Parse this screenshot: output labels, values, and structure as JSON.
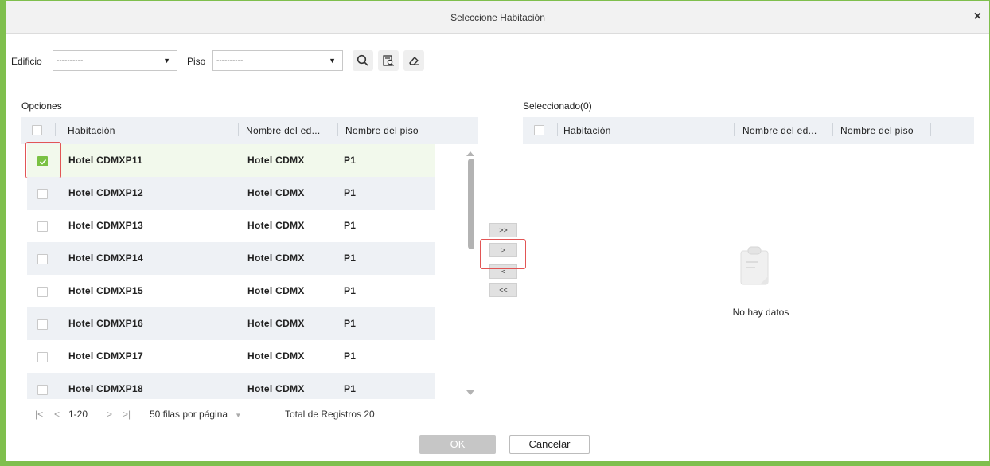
{
  "dialog": {
    "title": "Seleccione Habitación",
    "close_label": "×"
  },
  "filters": {
    "building_label": "Edificio",
    "building_value": "----------",
    "floor_label": "Piso",
    "floor_value": "----------"
  },
  "icons": {
    "search": "search-icon",
    "advanced_search": "advanced-search-icon",
    "clear": "eraser-icon",
    "empty": "clipboard-icon"
  },
  "colors": {
    "accent": "#7ac143",
    "border": "#7fbf4d",
    "highlight": "#e25555"
  },
  "options": {
    "section_label": "Opciones",
    "columns": [
      "Habitación",
      "Nombre del ed...",
      "Nombre del piso"
    ],
    "rows": [
      {
        "room": "Hotel CDMXP11",
        "building": "Hotel CDMX",
        "floor": "P1",
        "checked": true
      },
      {
        "room": "Hotel CDMXP12",
        "building": "Hotel CDMX",
        "floor": "P1",
        "checked": false
      },
      {
        "room": "Hotel CDMXP13",
        "building": "Hotel CDMX",
        "floor": "P1",
        "checked": false
      },
      {
        "room": "Hotel CDMXP14",
        "building": "Hotel CDMX",
        "floor": "P1",
        "checked": false
      },
      {
        "room": "Hotel CDMXP15",
        "building": "Hotel CDMX",
        "floor": "P1",
        "checked": false
      },
      {
        "room": "Hotel CDMXP16",
        "building": "Hotel CDMX",
        "floor": "P1",
        "checked": false
      },
      {
        "room": "Hotel CDMXP17",
        "building": "Hotel CDMX",
        "floor": "P1",
        "checked": false
      },
      {
        "room": "Hotel CDMXP18",
        "building": "Hotel CDMX",
        "floor": "P1",
        "checked": false
      }
    ]
  },
  "transfer": {
    "all_right": ">>",
    "right": ">",
    "left": "<",
    "all_left": "<<"
  },
  "pager": {
    "first": "|<",
    "prev": "<",
    "range": "1-20",
    "next": ">",
    "last": ">|",
    "page_size": "50 filas por página",
    "page_size_arrow": "▼",
    "total": "Total de Registros 20"
  },
  "selected": {
    "section_label": "Seleccionado(0)",
    "columns": [
      "Habitación",
      "Nombre del ed...",
      "Nombre del piso"
    ],
    "empty_text": "No hay datos"
  },
  "footer": {
    "ok_label": "OK",
    "cancel_label": "Cancelar"
  }
}
